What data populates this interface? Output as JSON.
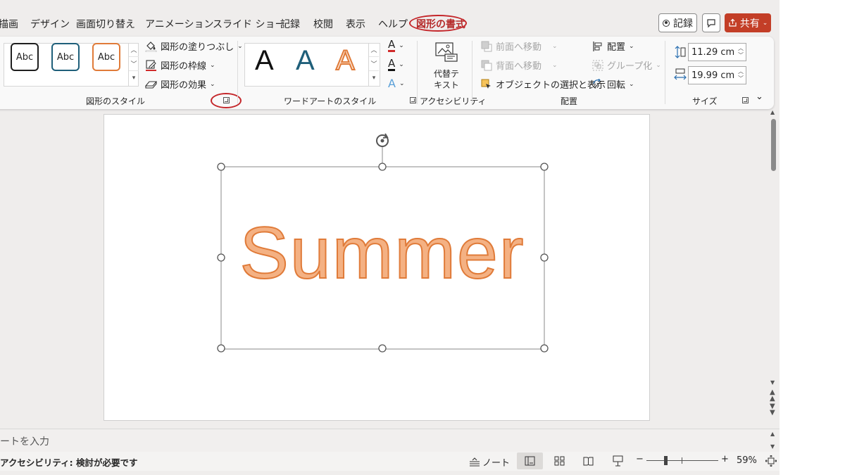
{
  "tabs": [
    {
      "label": "描画",
      "active": false
    },
    {
      "label": "デザイン",
      "active": false
    },
    {
      "label": "画面切り替え",
      "active": false
    },
    {
      "label": "アニメーション",
      "active": false
    },
    {
      "label": "スライド ショー",
      "active": false
    },
    {
      "label": "記録",
      "active": false
    },
    {
      "label": "校閲",
      "active": false
    },
    {
      "label": "表示",
      "active": false
    },
    {
      "label": "ヘルプ",
      "active": false
    },
    {
      "label": "図形の書式",
      "active": true
    }
  ],
  "header": {
    "record_label": "記録",
    "share_label": "共有"
  },
  "ribbon": {
    "shape_styles": {
      "group_label": "図形のスタイル",
      "samples": [
        {
          "label": "Abc",
          "color": "#1f1f1f"
        },
        {
          "label": "Abc",
          "color": "#1f5f7a"
        },
        {
          "label": "Abc",
          "color": "#e07b39"
        }
      ],
      "fill_label": "図形の塗りつぶし",
      "outline_label": "図形の枠線",
      "effects_label": "図形の効果"
    },
    "wordart": {
      "group_label": "ワードアートのスタイル",
      "samples": [
        {
          "label": "A",
          "color": "#111111"
        },
        {
          "label": "A",
          "color": "#1f5f7a"
        },
        {
          "label": "A",
          "color": "#e07b39"
        }
      ],
      "text_fill_letter": "A",
      "text_outline_letter": "A",
      "text_effects_letter": "A"
    },
    "accessibility": {
      "group_label": "アクセシビリティ",
      "alt_text_line1": "代替テ",
      "alt_text_line2": "キスト"
    },
    "arrange": {
      "group_label": "配置",
      "bring_forward": "前面へ移動",
      "send_backward": "背面へ移動",
      "selection_pane": "オブジェクトの選択と表示",
      "align": "配置",
      "group": "グループ化",
      "rotate": "回転"
    },
    "size": {
      "group_label": "サイズ",
      "height": "11.29 cm",
      "width": "19.99 cm"
    }
  },
  "slide": {
    "text": "Summer",
    "text_color": "#f4b183",
    "text_outline_color": "#e07b39"
  },
  "notes": {
    "placeholder": "ートを入力"
  },
  "status": {
    "accessibility": "アクセシビリティ: 検討が必要です",
    "notes_label": "ノート",
    "zoom": "59%",
    "zoom_minus": "−",
    "zoom_plus": "+"
  },
  "colors": {
    "accent": "#c33e27",
    "annotation_ring": "#c4262a"
  }
}
